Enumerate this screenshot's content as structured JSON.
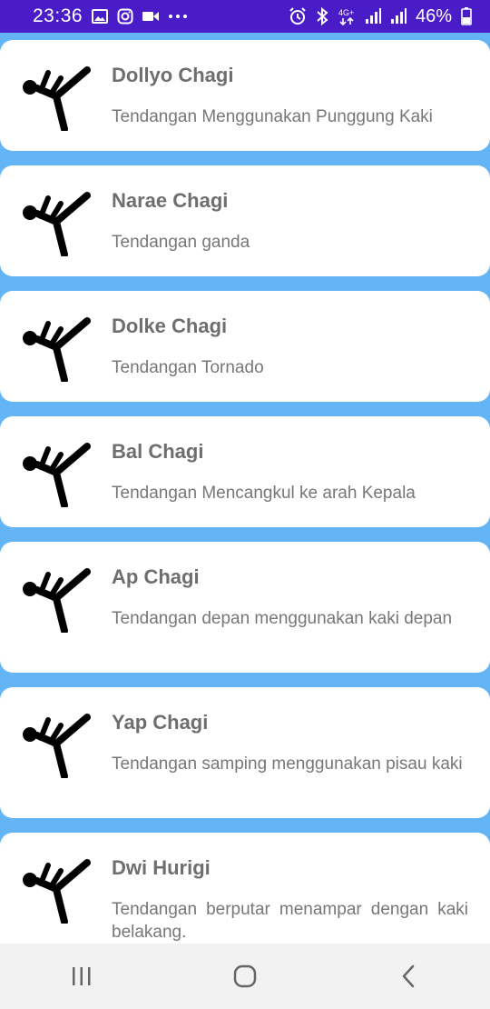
{
  "status_bar": {
    "time": "23:36",
    "battery": "46%",
    "left_icons": [
      "image-icon",
      "instagram-icon",
      "video-icon",
      "more-icon"
    ],
    "right_icons": [
      "alarm-icon",
      "bluetooth-icon",
      "4g-icon",
      "signal-icon",
      "signal-icon",
      "battery-icon"
    ]
  },
  "items": [
    {
      "title": "Dollyo Chagi",
      "desc": "Tendangan Menggunakan Punggung Kaki"
    },
    {
      "title": "Narae Chagi",
      "desc": "Tendangan ganda"
    },
    {
      "title": "Dolke Chagi",
      "desc": "Tendangan Tornado"
    },
    {
      "title": "Bal Chagi",
      "desc": "Tendangan Mencangkul ke arah Kepala"
    },
    {
      "title": "Ap Chagi",
      "desc": "Tendangan depan menggunakan kaki depan"
    },
    {
      "title": "Yap Chagi",
      "desc": "Tendangan samping menggunakan pisau kaki"
    },
    {
      "title": "Dwi Hurigi",
      "desc": "Tendangan berputar menampar dengan kaki belakang."
    }
  ],
  "nav": [
    "recent-apps-icon",
    "home-icon",
    "back-icon"
  ],
  "colors": {
    "status_bar": "#4a1cc8",
    "background": "#64b5f6",
    "card": "#ffffff"
  }
}
